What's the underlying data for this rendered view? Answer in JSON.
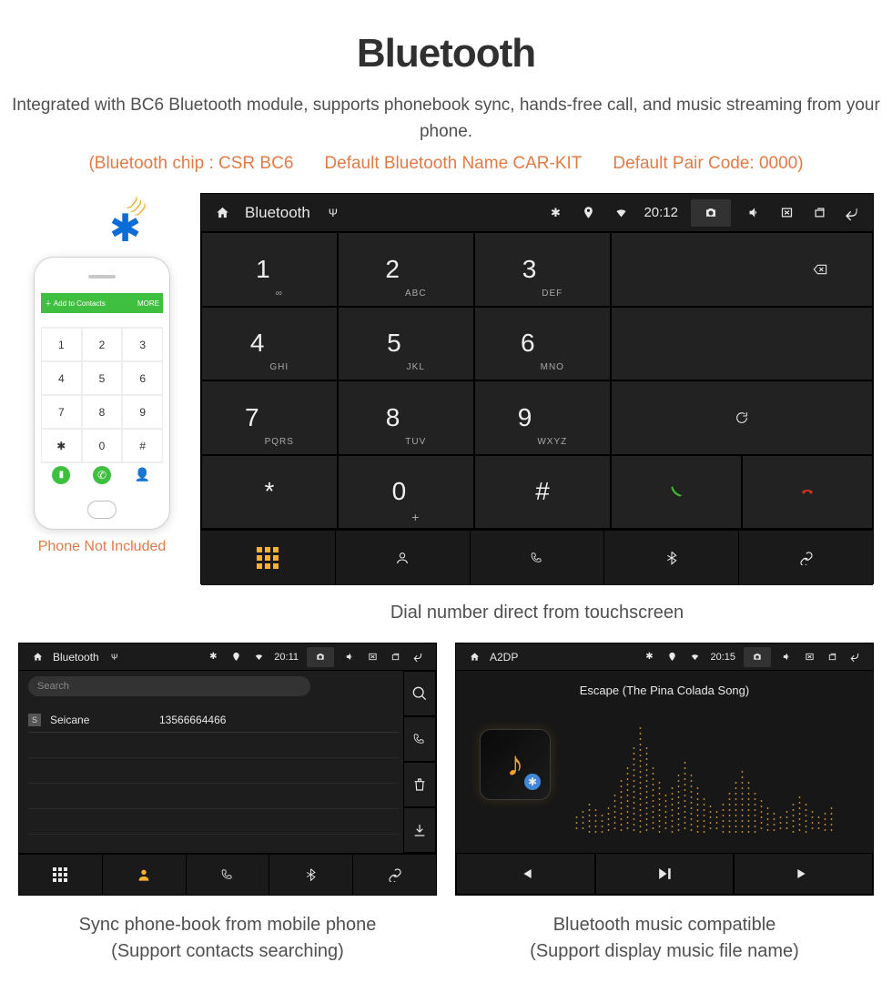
{
  "header": {
    "title": "Bluetooth",
    "subtitle": "Integrated with BC6 Bluetooth module, supports phonebook sync, hands-free call, and music streaming from your phone.",
    "specs": {
      "chip": "(Bluetooth chip : CSR BC6",
      "name": "Default Bluetooth Name CAR-KIT",
      "code": "Default Pair Code: 0000)"
    }
  },
  "phone_caption": "Phone Not Included",
  "phone_bar_left": "＋  Add to Contacts",
  "phone_bar_right": "MORE",
  "unit_main": {
    "status_title": "Bluetooth",
    "time": "20:12",
    "keys": [
      {
        "n": "1",
        "l": "∞"
      },
      {
        "n": "2",
        "l": "ABC"
      },
      {
        "n": "3",
        "l": "DEF"
      },
      {
        "n": "4",
        "l": "GHI"
      },
      {
        "n": "5",
        "l": "JKL"
      },
      {
        "n": "6",
        "l": "MNO"
      },
      {
        "n": "7",
        "l": "PQRS"
      },
      {
        "n": "8",
        "l": "TUV"
      },
      {
        "n": "9",
        "l": "WXYZ"
      },
      {
        "n": "*",
        "l": ""
      },
      {
        "n": "0",
        "l": "+"
      },
      {
        "n": "#",
        "l": ""
      }
    ]
  },
  "caption_main": "Dial number direct from touchscreen",
  "unit_pb": {
    "status_title": "Bluetooth",
    "time": "20:11",
    "search_placeholder": "Search",
    "contact_tag": "S",
    "contact_name": "Seicane",
    "contact_number": "13566664466"
  },
  "caption_pb_l1": "Sync phone-book from mobile phone",
  "caption_pb_l2": "(Support contacts searching)",
  "unit_a2": {
    "status_title": "A2DP",
    "time": "20:15",
    "track": "Escape (The Pina Colada Song)"
  },
  "caption_a2_l1": "Bluetooth music compatible",
  "caption_a2_l2": "(Support display music file name)"
}
